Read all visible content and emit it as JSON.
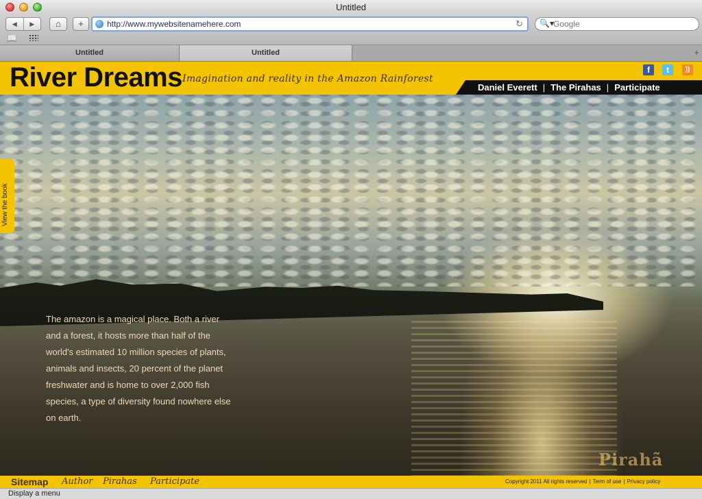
{
  "window": {
    "title": "Untitled"
  },
  "toolbar": {
    "back_icon": "back-arrow-icon",
    "forward_icon": "forward-arrow-icon",
    "home_glyph": "⌂",
    "add_glyph": "+",
    "url": "http://www.mywebsitenamehere.com",
    "reload_glyph": "↻",
    "search_placeholder": "Google",
    "search_glyph": "🔍▾",
    "bookmarks_glyph": "📖"
  },
  "tabs": [
    {
      "label": "Untitled",
      "active": false
    },
    {
      "label": "Untitled",
      "active": true
    }
  ],
  "tab_new_glyph": "+",
  "site": {
    "logo": "River Dreams",
    "tagline": "Imagination and reality in the Amazon Rainforest",
    "nav": [
      "Daniel Everett",
      "The Pirahas",
      "Participate"
    ],
    "nav_separator": "|",
    "social": {
      "facebook": "f",
      "twitter": "t",
      "rss": "))"
    },
    "side_tab": "View the book",
    "intro": "The amazon is a magical place. Both a river and a forest, it hosts more than half of the world's estimated 10 million species of plants, animals and insects, 20 percent of the planet freshwater and is home to over 2,000 fish species, a type of diversity found nowhere else on earth.",
    "watermark": "Pirahã"
  },
  "footer": {
    "sitemap": "Sitemap",
    "links": [
      "Author",
      "Pirahas",
      "Participate"
    ],
    "copyright": "Copyright 2011 All rights reserved",
    "terms": "Term of use",
    "privacy": "Privacy policy",
    "separator": "|"
  },
  "status": {
    "text": "Display a menu"
  },
  "colors": {
    "brand_yellow": "#f5c400",
    "nav_black": "#111111",
    "intro_text": "#f1d8b8"
  }
}
